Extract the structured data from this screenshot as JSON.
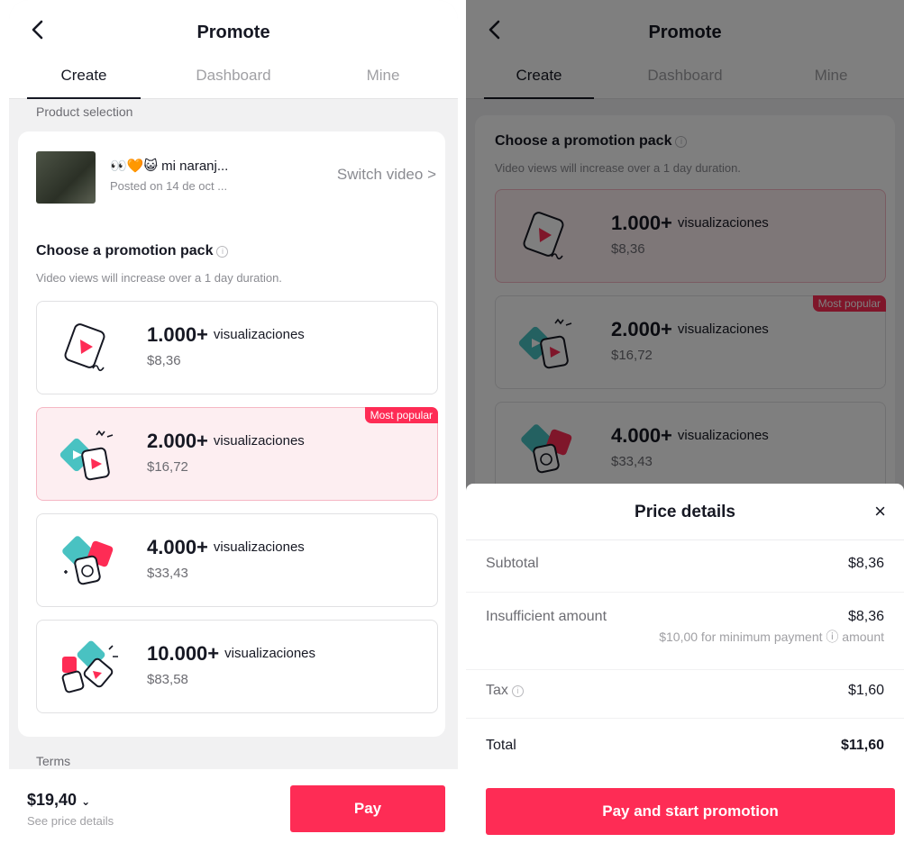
{
  "left": {
    "header": {
      "title": "Promote",
      "tabs": [
        {
          "label": "Create"
        },
        {
          "label": "Dashboard"
        },
        {
          "label": "Mine"
        }
      ]
    },
    "product_selection_label": "Product selection",
    "video": {
      "title": "👀🧡😺 mi naranj...",
      "posted": "Posted on 14 de oct ...",
      "switch_label": "Switch video >"
    },
    "pack_section": {
      "heading": "Choose a promotion pack",
      "subtitle": "Video views will increase over a 1 day duration."
    },
    "packs": [
      {
        "views": "1.000+",
        "unit": "visualizaciones",
        "price": "$8,36"
      },
      {
        "views": "2.000+",
        "unit": "visualizaciones",
        "price": "$16,72",
        "badge": "Most popular"
      },
      {
        "views": "4.000+",
        "unit": "visualizaciones",
        "price": "$33,43"
      },
      {
        "views": "10.000+",
        "unit": "visualizaciones",
        "price": "$83,58"
      }
    ],
    "terms_label": "Terms",
    "footer": {
      "total": "$19,40",
      "see_details": "See price details",
      "pay_label": "Pay"
    }
  },
  "right": {
    "header": {
      "title": "Promote",
      "tabs": [
        {
          "label": "Create"
        },
        {
          "label": "Dashboard"
        },
        {
          "label": "Mine"
        }
      ]
    },
    "pack_section": {
      "heading": "Choose a promotion pack",
      "subtitle": "Video views will increase over a 1 day duration."
    },
    "packs": [
      {
        "views": "1.000+",
        "unit": "visualizaciones",
        "price": "$8,36"
      },
      {
        "views": "2.000+",
        "unit": "visualizaciones",
        "price": "$16,72",
        "badge": "Most popular"
      },
      {
        "views": "4.000+",
        "unit": "visualizaciones",
        "price": "$33,43"
      }
    ],
    "price_details": {
      "title": "Price details",
      "close": "×",
      "subtotal_label": "Subtotal",
      "subtotal_value": "$8,36",
      "insufficient_label": "Insufficient amount",
      "insufficient_value": "$8,36",
      "insufficient_note": "$10,00 for minimum payment ⓘ amount",
      "tax_label": "Tax",
      "tax_value": "$1,60",
      "total_label": "Total",
      "total_value": "$11,60",
      "button_label": "Pay and start promotion"
    }
  },
  "colors": {
    "accent": "#fe2c55",
    "selected_bg": "#fdeef1",
    "teal": "#49c2c2",
    "text": "#161823"
  }
}
